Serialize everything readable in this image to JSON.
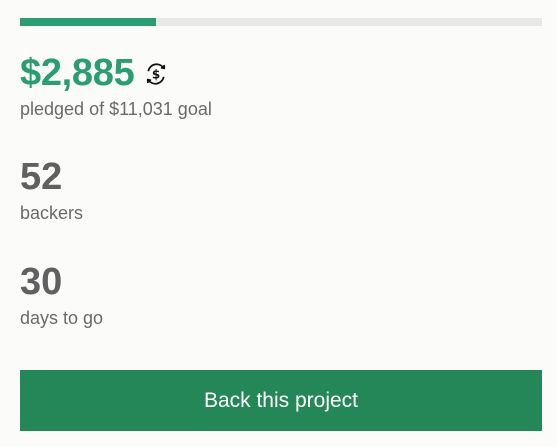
{
  "campaign": {
    "progress_fraction": 0.26,
    "pledged": "$2,885",
    "pledged_caption": "pledged of $11,031 goal",
    "backers_count": "52",
    "backers_caption": "backers",
    "days_count": "30",
    "days_caption": "days to go",
    "cta_label": "Back this project",
    "currency_icon": "currency-conversion-icon"
  },
  "colors": {
    "accent": "#2a9d75",
    "button": "#238757",
    "track": "#e8e8e8",
    "text": "#6a6a6a"
  }
}
